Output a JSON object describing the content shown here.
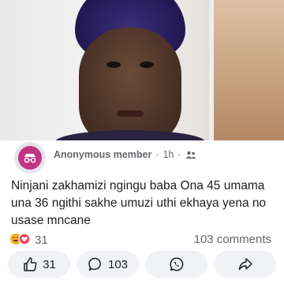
{
  "post": {
    "author_role": "Anonymous member",
    "time": "1h",
    "separator": "·",
    "text": "Ninjani zakhamizi ngingu baba Ona 45 umama una 36 ngithi sakhe umuzi uthi ekhaya yena no usase mncane",
    "reaction_count": "31",
    "comments_count": "103 comments"
  },
  "actions": {
    "like_count": "31",
    "comment_count": "103"
  },
  "icons": {
    "avatar": "incognito-icon",
    "group": "group-icon",
    "reaction": "haha-love-emoji-icon",
    "like": "thumbs-up-icon",
    "comment": "speech-bubble-icon",
    "whatsapp": "whatsapp-icon",
    "share": "share-icon"
  }
}
